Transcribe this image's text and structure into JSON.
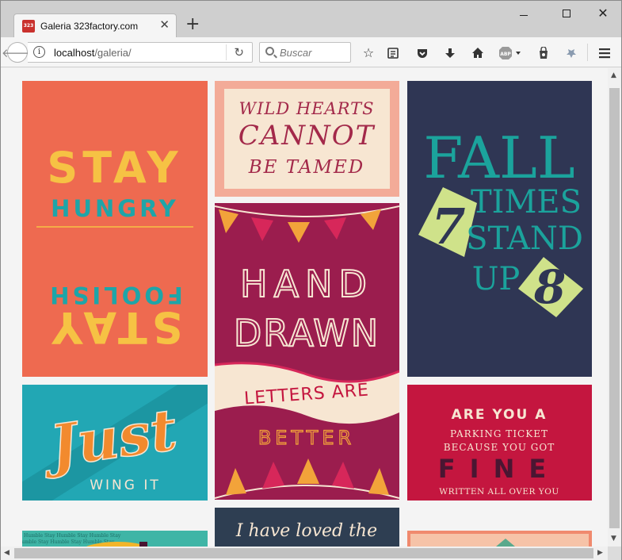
{
  "browser": {
    "tab_title": "Galeria 323factory.com",
    "favicon_text": "323",
    "close_glyph": "✕",
    "newtab_glyph": "+",
    "url_host": "localhost",
    "url_path": "/galeria/",
    "search_placeholder": "Buscar",
    "abp_label": "ABP"
  },
  "icons": [
    "back-arrow-icon",
    "info-icon",
    "reload-icon",
    "search-icon",
    "bookmark-star-icon",
    "reading-list-icon",
    "pocket-icon",
    "download-icon",
    "home-icon",
    "adblock-icon",
    "shopping-bag-icon",
    "extension-icon",
    "menu-icon"
  ],
  "gallery": {
    "posters": [
      {
        "id": "stay-hungry",
        "lines": [
          "STAY",
          "HUNGRY",
          "FOOLISH",
          "STAY"
        ],
        "bg": "#ee6a50"
      },
      {
        "id": "wild-hearts",
        "lines": [
          "WILD HEARTS",
          "CANNOT",
          "BE TAMED"
        ],
        "bg": "#f7e6d2"
      },
      {
        "id": "fall-seven",
        "lines": [
          "FALL",
          "7",
          "TIMES",
          "STAND",
          "UP",
          "8"
        ],
        "bg": "#2f3654"
      },
      {
        "id": "hand-drawn",
        "lines": [
          "HAND",
          "DRAWN",
          "LETTERS ARE",
          "BETTER"
        ],
        "bg": "#9b1d4e"
      },
      {
        "id": "just-wing-it",
        "lines": [
          "Just",
          "WING IT"
        ],
        "bg": "#22a7b4"
      },
      {
        "id": "parking-ticket",
        "lines": [
          "ARE YOU A",
          "PARKING TICKET",
          "BECAUSE YOU GOT",
          "FINE",
          "WRITTEN ALL OVER YOU"
        ],
        "bg": "#c4163f"
      },
      {
        "id": "loved-the",
        "lines": [
          "I have loved the"
        ],
        "bg": "#2e3e52"
      },
      {
        "id": "stay-humble",
        "lines": [
          "Humble Stay Humble Stay Humble Stay"
        ],
        "bg": "#3fb5a6"
      },
      {
        "id": "peach-pattern",
        "lines": [],
        "bg": "#f08a6e"
      }
    ]
  }
}
